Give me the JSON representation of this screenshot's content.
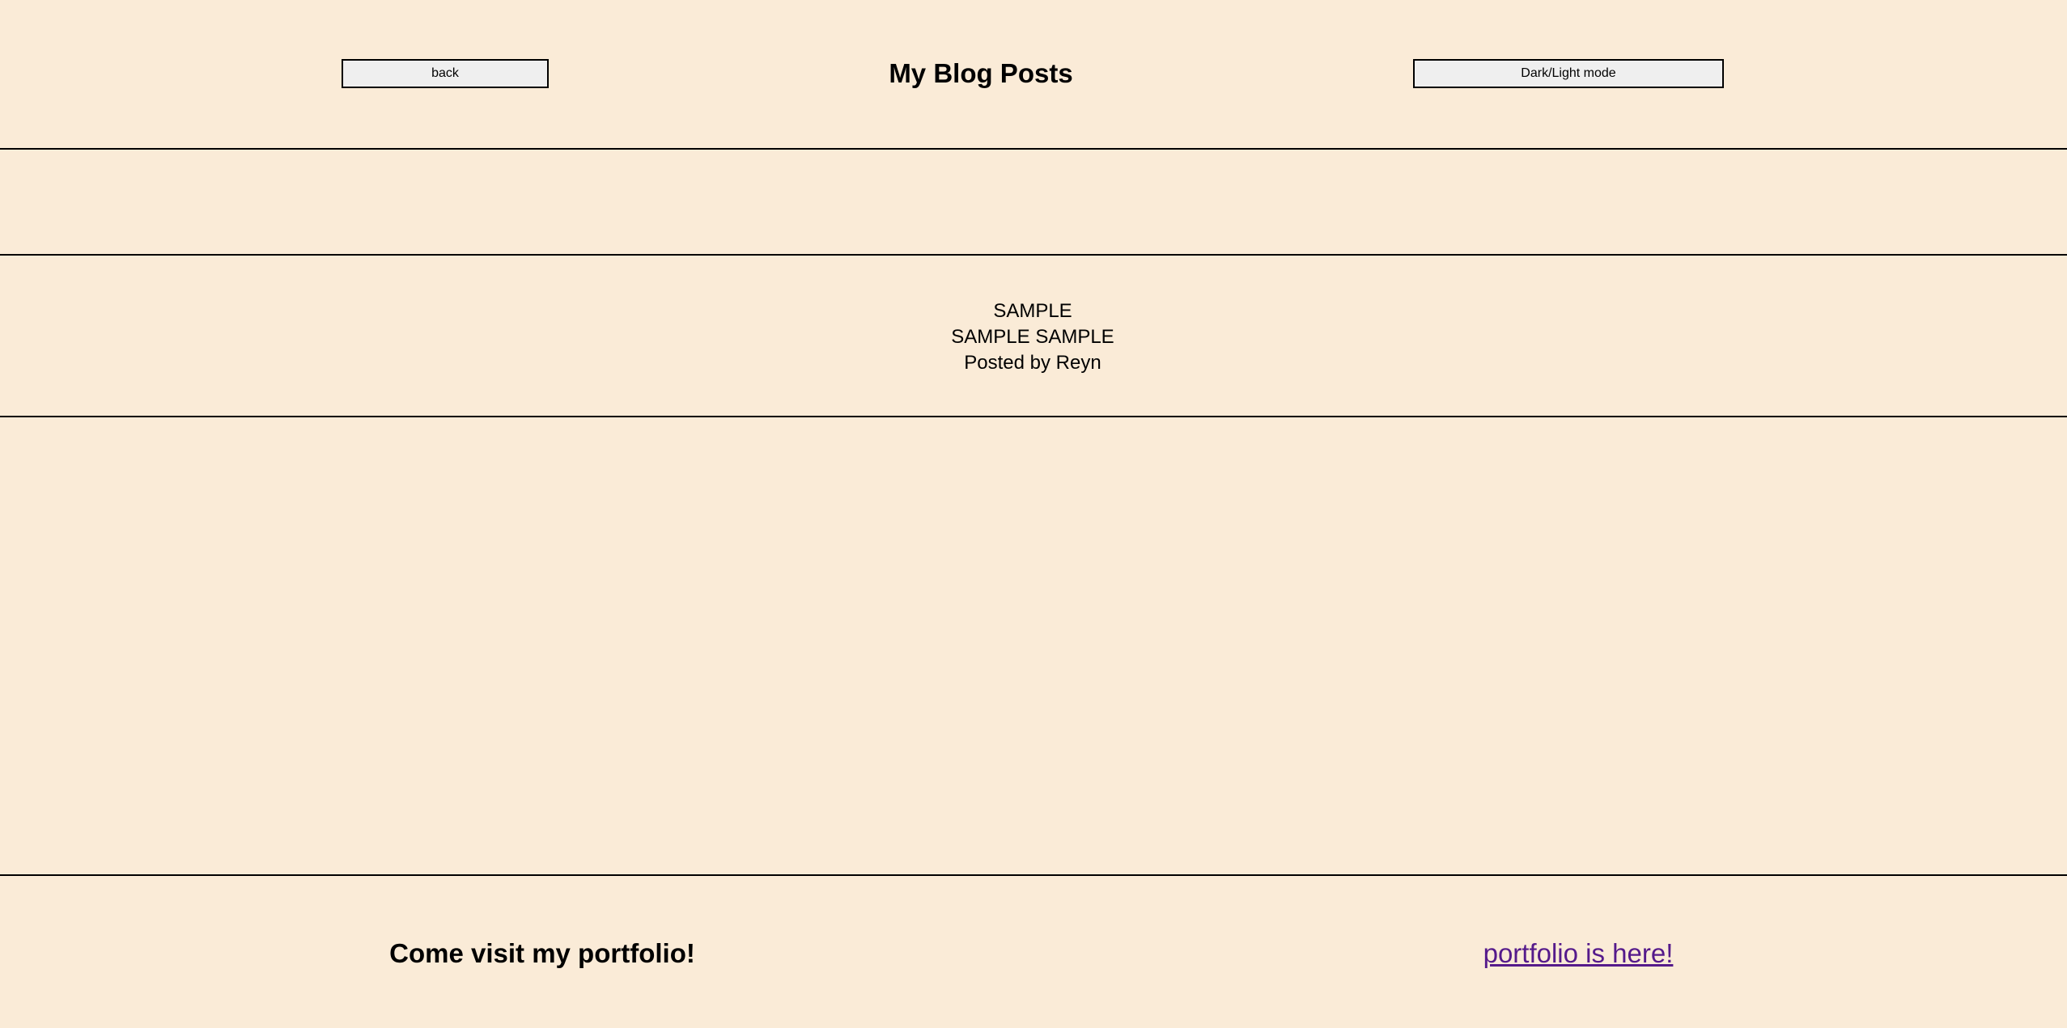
{
  "header": {
    "back_label": "back",
    "title": "My Blog Posts",
    "mode_toggle_label": "Dark/Light mode"
  },
  "post": {
    "title": "SAMPLE",
    "body": "SAMPLE SAMPLE",
    "byline": "Posted by Reyn"
  },
  "footer": {
    "text": "Come visit my portfolio!",
    "link_label": "portfolio is here!"
  },
  "colors": {
    "background": "#faebd7",
    "button_background": "#efefef",
    "link_visited": "#551a8b"
  }
}
